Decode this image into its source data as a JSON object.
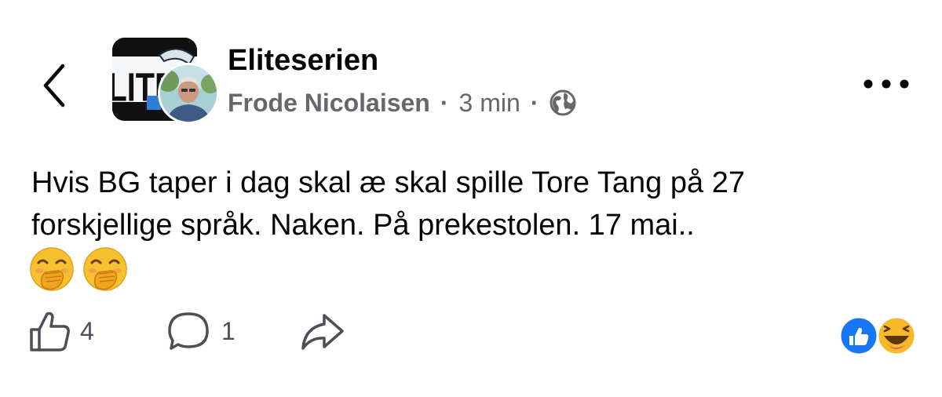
{
  "header": {
    "back_icon": "chevron-left-icon",
    "group_name": "Eliteserien",
    "group_avatar_text": "LITE",
    "author": "Frode Nicolaisen",
    "separator": "·",
    "time": "3 min",
    "audience_icon": "globe-icon",
    "more_icon": "more-dots-icon"
  },
  "post": {
    "lines": [
      "Hvis BG taper i dag skal æ skal spille Tore Tang på 27",
      "forskjellige språk. Naken. På prekestolen. 17 mai.."
    ],
    "emojis": [
      "face-with-hand-over-mouth",
      "face-with-hand-over-mouth"
    ]
  },
  "actions": {
    "like_icon": "thumbs-up-icon",
    "like_count": "4",
    "comment_icon": "comment-bubble-icon",
    "comment_count": "1",
    "share_icon": "share-arrow-icon"
  },
  "reactions": [
    "like",
    "haha"
  ],
  "colors": {
    "text": "#050505",
    "secondary": "#65676b",
    "like_blue": "#1877f2",
    "emoji_yellow": "#f7b928"
  }
}
